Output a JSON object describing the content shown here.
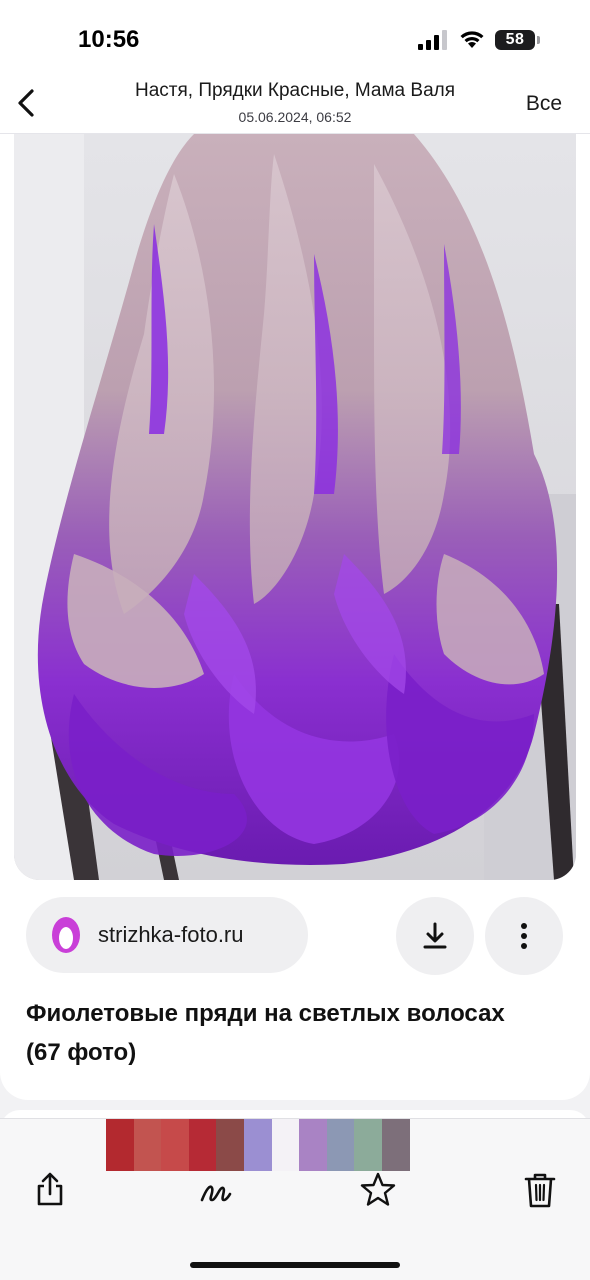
{
  "status_bar": {
    "time": "10:56",
    "battery_level": "58"
  },
  "header": {
    "title": "Настя, Прядки Красные, Мама Валя",
    "subtitle": "05.06.2024, 06:52",
    "all_label": "Все"
  },
  "pin": {
    "source": "strizhka-foto.ru",
    "title": "Фиолетовые пряди на светлых волосах (67 фото)"
  },
  "thumbnails": {
    "colors": [
      "#b3292f",
      "#c25450",
      "#c64a4a",
      "#b62a35",
      "#8b4a48",
      "#9b8fd2",
      "#f4f2f6",
      "#a983c4",
      "#8c98b4",
      "#8cab9a",
      "#7d6f7a"
    ]
  },
  "icons": {
    "back": "chevron-left-icon",
    "download": "download-icon",
    "more": "more-vertical-icon",
    "share": "share-icon",
    "markup": "markup-icon",
    "favorite": "star-icon",
    "delete": "trash-icon"
  },
  "colors": {
    "accent_purple": "#8a2be2",
    "source_logo": "#c93fd8"
  }
}
